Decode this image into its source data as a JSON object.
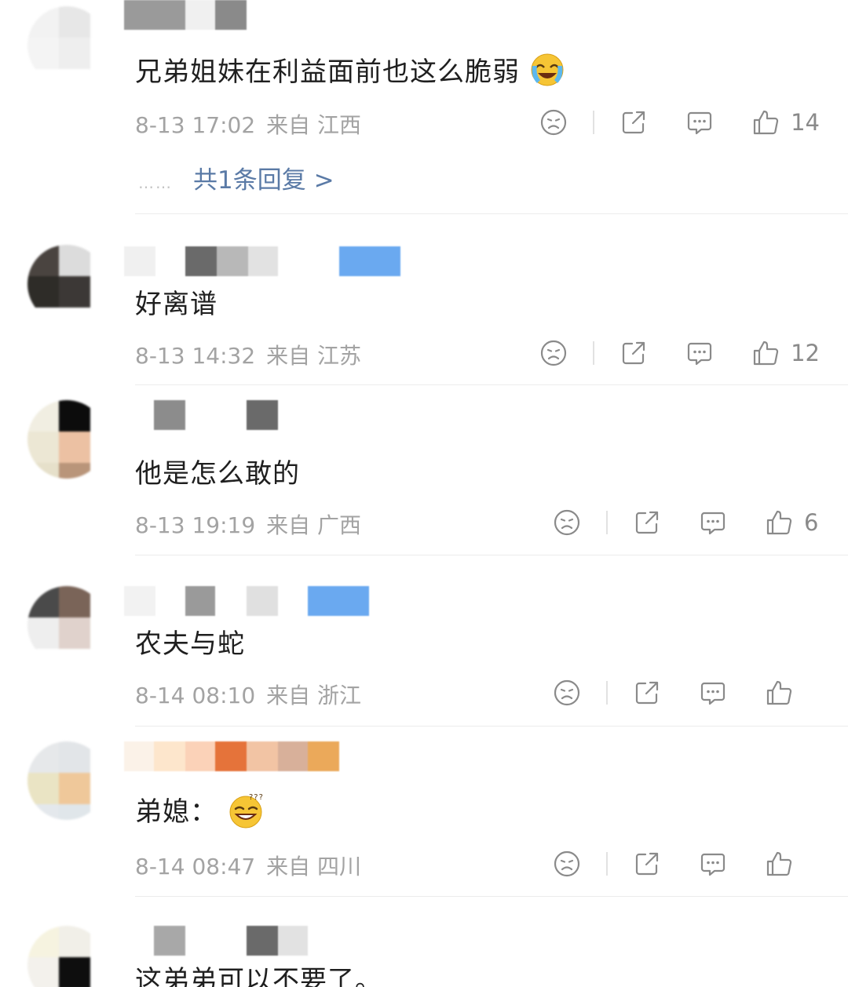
{
  "comments": [
    {
      "text": "兄弟姐妹在利益面前也这么脆弱",
      "emoji": "loudly-crying-laughing-emoji",
      "date": "8-13 17:02",
      "location": "来自 江西",
      "likes": "14",
      "reply_summary": "共1条回复 >",
      "reply_dots": "……"
    },
    {
      "text": "好离谱",
      "date": "8-13 14:32",
      "location": "来自 江苏",
      "likes": "12"
    },
    {
      "text": "他是怎么敢的",
      "date": "8-13 19:19",
      "location": "来自 广西",
      "likes": "6"
    },
    {
      "text": "农夫与蛇",
      "date": "8-14 08:10",
      "location": "来自 浙江",
      "likes": ""
    },
    {
      "text": "弟媳：",
      "emoji": "confused-grinning-emoji",
      "date": "8-14 08:47",
      "location": "来自 四川",
      "likes": ""
    },
    {
      "text": "这弟弟可以不要了。"
    }
  ],
  "icons": {
    "dislike": "sad-face-icon",
    "share": "share-icon",
    "comment": "comment-bubble-icon",
    "like": "thumbs-up-icon"
  },
  "colors": {
    "link": "#5a7aa6",
    "meta": "#a3a3a3",
    "text": "#1f1f1f"
  }
}
